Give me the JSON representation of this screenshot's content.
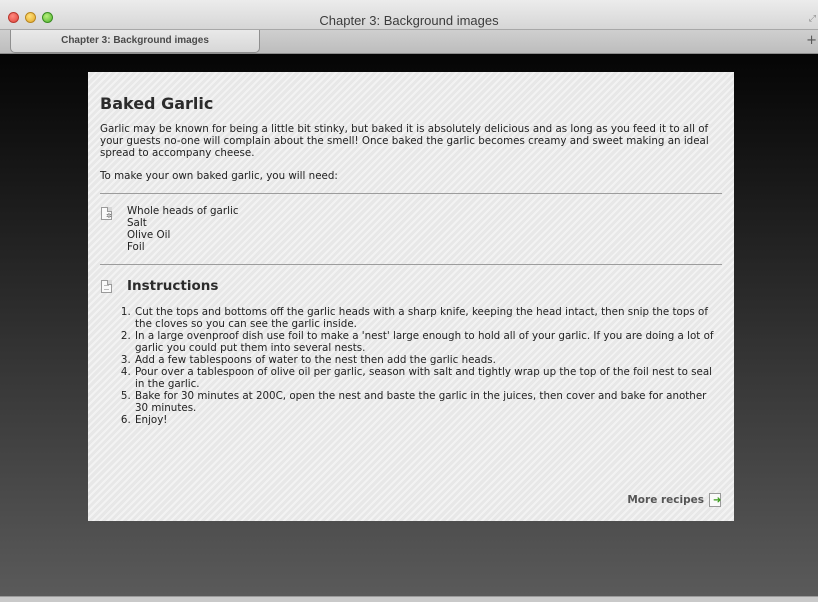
{
  "window": {
    "title": "Chapter 3: Background images",
    "tab_label": "Chapter 3: Background images",
    "new_tab_symbol": "+",
    "resize_symbol": "⤢"
  },
  "recipe": {
    "title": "Baked Garlic",
    "intro": "Garlic may be known for being a little bit stinky, but baked it is absolutely delicious and as long as you feed it to all of your guests no-one will complain about the smell! Once baked the garlic becomes creamy and sweet making an ideal spread to accompany cheese.",
    "need_text": "To make your own baked garlic, you will need:",
    "ingredients": [
      "Whole heads of garlic",
      "Salt",
      "Olive Oil",
      "Foil"
    ],
    "instructions_title": "Instructions",
    "steps": [
      "Cut the tops and bottoms off the garlic heads with a sharp knife, keeping the head intact, then snip the tops of the cloves so you can see the garlic inside.",
      "In a large ovenproof dish use foil to make a 'nest' large enough to hold all of your garlic. If you are doing a lot of garlic you could put them into several nests.",
      "Add a few tablespoons of water to the nest then add the garlic heads.",
      "Pour over a tablespoon of olive oil per garlic, season with salt and tightly wrap up the top of the foil nest to seal in the garlic.",
      "Bake for 30 minutes at 200C, open the nest and baste the garlic in the juices, then cover and bake for another 30 minutes.",
      "Enjoy!"
    ],
    "more_label": "More recipes"
  },
  "icons": {
    "ingredients_icon": "document-gear-icon",
    "instructions_icon": "document-icon",
    "more_icon": "document-arrow-icon"
  },
  "colors": {
    "card_background": "#ececec",
    "arrow_green": "#3a9a1c"
  }
}
